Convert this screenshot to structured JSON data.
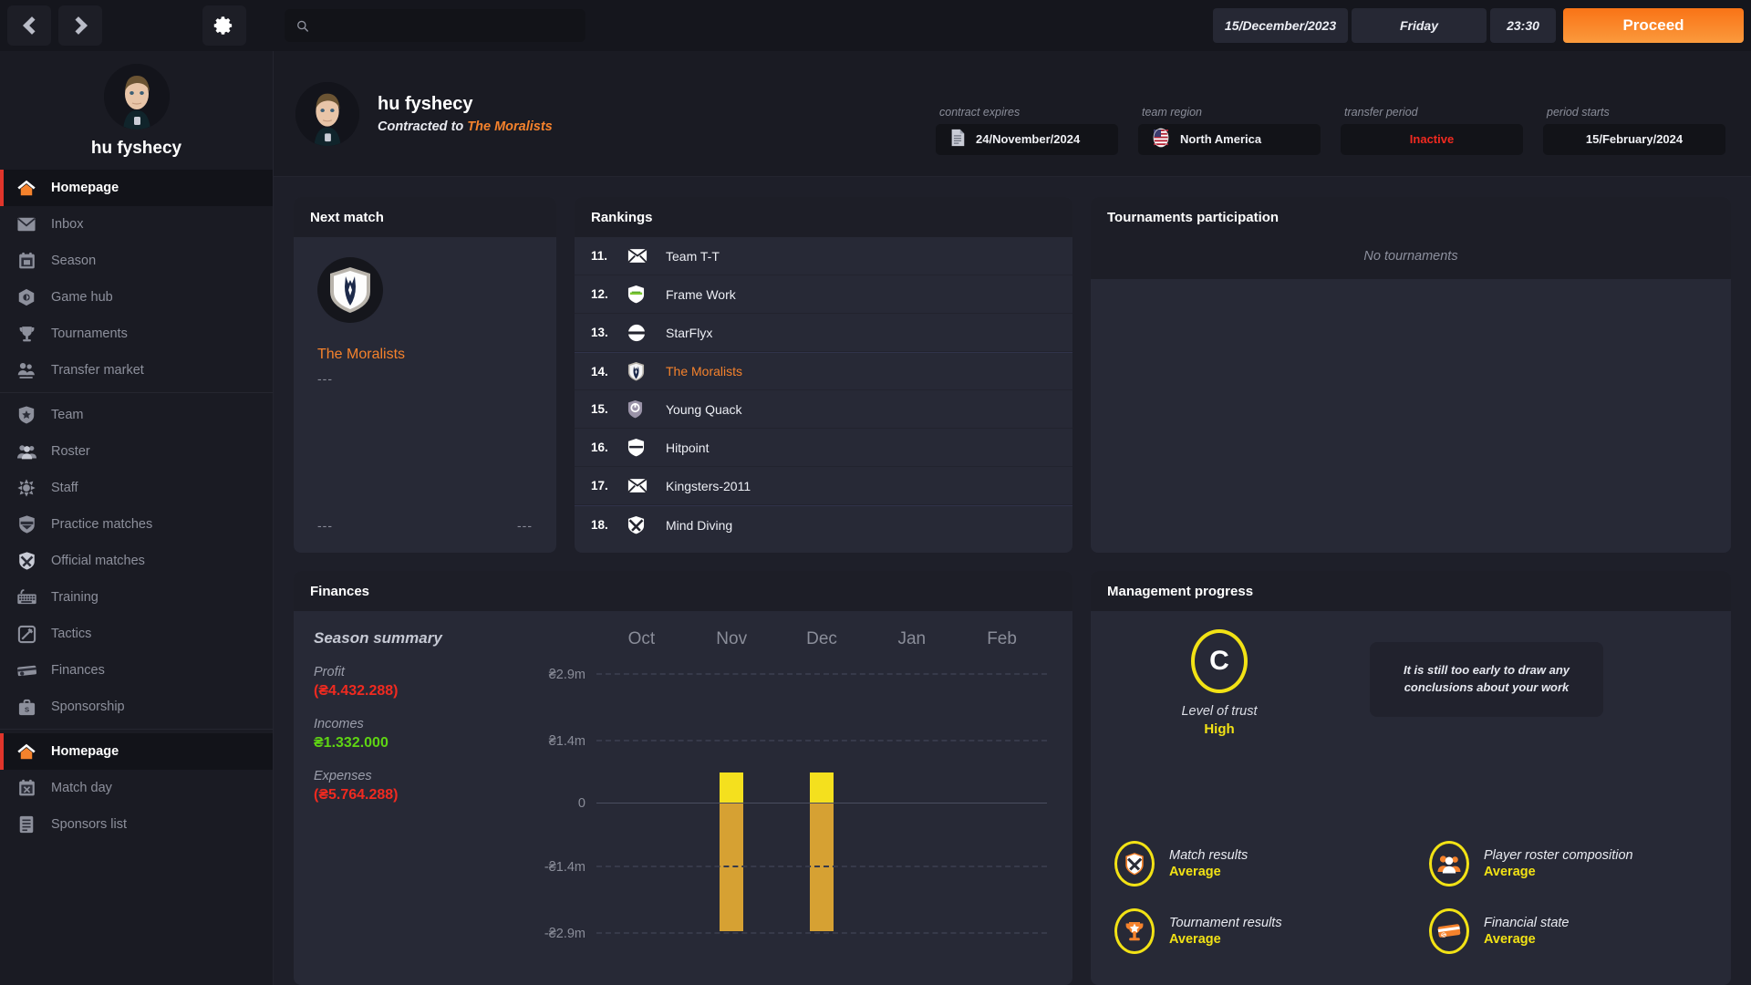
{
  "topbar": {
    "back_icon": "chevron-left-icon",
    "forward_icon": "chevron-right-icon",
    "settings_icon": "gear-icon",
    "search_placeholder": "",
    "search_value": "",
    "date": "15/December/2023",
    "weekday": "Friday",
    "time": "23:30",
    "proceed_label": "Proceed"
  },
  "sidebar": {
    "player_name": "hu fyshecy",
    "items": [
      {
        "label": "Homepage",
        "icon": "home-icon",
        "active": true
      },
      {
        "label": "Inbox",
        "icon": "envelope-icon",
        "active": false
      },
      {
        "label": "Season",
        "icon": "calendar-icon",
        "active": false
      },
      {
        "label": "Game hub",
        "icon": "hub-icon",
        "active": false
      },
      {
        "label": "Tournaments",
        "icon": "trophy-icon",
        "active": false
      },
      {
        "label": "Transfer market",
        "icon": "transfer-icon",
        "active": false
      },
      {
        "label": "Team",
        "icon": "shield-star-icon",
        "active": false
      },
      {
        "label": "Roster",
        "icon": "people-icon",
        "active": false
      },
      {
        "label": "Staff",
        "icon": "staff-icon",
        "active": false
      },
      {
        "label": "Practice matches",
        "icon": "shield-practice-icon",
        "active": false
      },
      {
        "label": "Official matches",
        "icon": "shield-x-icon",
        "active": false
      },
      {
        "label": "Training",
        "icon": "keyboard-icon",
        "active": false
      },
      {
        "label": "Tactics",
        "icon": "tactics-icon",
        "active": false
      },
      {
        "label": "Finances",
        "icon": "card-icon",
        "active": false
      },
      {
        "label": "Sponsorship",
        "icon": "briefcase-icon",
        "active": false
      },
      {
        "label": "Homepage",
        "icon": "home-icon",
        "active": true
      },
      {
        "label": "Match day",
        "icon": "calendar-x-icon",
        "active": false
      },
      {
        "label": "Sponsors list",
        "icon": "list-icon",
        "active": false
      }
    ]
  },
  "player_header": {
    "name": "hu fyshecy",
    "contract_prefix": "Contracted to",
    "team": "The Moralists",
    "metas": [
      {
        "label": "contract expires",
        "value": "24/November/2024",
        "icon": "document-icon",
        "style": "normal"
      },
      {
        "label": "team region",
        "value": "North America",
        "icon": "flag-usa-icon",
        "style": "normal"
      },
      {
        "label": "transfer period",
        "value": "Inactive",
        "icon": "",
        "style": "red"
      },
      {
        "label": "period starts",
        "value": "15/February/2024",
        "icon": "",
        "style": "normal"
      }
    ]
  },
  "next_match": {
    "title": "Next match",
    "team": "The Moralists",
    "score": "---",
    "foot_left": "---",
    "foot_right": "---"
  },
  "rankings": {
    "title": "Rankings",
    "rows": [
      {
        "pos": "11.",
        "team": "Team T-T",
        "logo": "envelope-logo",
        "highlight": false
      },
      {
        "pos": "12.",
        "team": "Frame Work",
        "logo": "shield-green-logo",
        "highlight": false
      },
      {
        "pos": "13.",
        "team": "StarFlyx",
        "logo": "circle-band-logo",
        "highlight": false
      },
      {
        "pos": "14.",
        "team": "The Moralists",
        "logo": "horse-shield-logo",
        "highlight": true
      },
      {
        "pos": "15.",
        "team": "Young Quack",
        "logo": "power-shield-logo",
        "highlight": false
      },
      {
        "pos": "16.",
        "team": "Hitpoint",
        "logo": "shield-white-logo",
        "highlight": false
      },
      {
        "pos": "17.",
        "team": "Kingsters-2011",
        "logo": "envelope-logo",
        "highlight": false
      },
      {
        "pos": "18.",
        "team": "Mind Diving",
        "logo": "shield-x-logo",
        "highlight": false
      }
    ]
  },
  "tournaments": {
    "title": "Tournaments participation",
    "empty_text": "No tournaments"
  },
  "finances": {
    "title": "Finances",
    "summary_title": "Season summary",
    "stats": [
      {
        "key": "Profit",
        "value": "(₴4.432.288)",
        "tone": "neg"
      },
      {
        "key": "Incomes",
        "value": "₴1.332.000",
        "tone": "pos"
      },
      {
        "key": "Expenses",
        "value": "(₴5.764.288)",
        "tone": "neg"
      }
    ]
  },
  "management": {
    "title": "Management progress",
    "trust_grade": "C",
    "trust_label": "Level of trust",
    "trust_value": "High",
    "message": "It is still too early to draw any conclusions about your work",
    "items": [
      {
        "label": "Match results",
        "value": "Average",
        "icon": "shield-x-icon"
      },
      {
        "label": "Player roster composition",
        "value": "Average",
        "icon": "people-icon"
      },
      {
        "label": "Tournament results",
        "value": "Average",
        "icon": "trophy-star-icon"
      },
      {
        "label": "Financial state",
        "value": "Average",
        "icon": "card-icon"
      }
    ]
  },
  "chart_data": {
    "type": "bar",
    "title": "Season summary",
    "categories": [
      "Oct",
      "Nov",
      "Dec",
      "Jan",
      "Feb"
    ],
    "series": [
      {
        "name": "Incomes",
        "values": [
          0,
          0.666,
          0.666,
          0,
          0
        ],
        "color": "#f4e01e"
      },
      {
        "name": "Expenses",
        "values": [
          0,
          -2.88,
          -2.88,
          0,
          0
        ],
        "color": "#d6a133"
      }
    ],
    "ytick_labels": [
      "₴2.9m",
      "₴1.4m",
      "0",
      "-₴1.4m",
      "-₴2.9m"
    ],
    "ytick_values": [
      2.9,
      1.4,
      0,
      -1.4,
      -2.9
    ],
    "ylim": [
      -2.9,
      2.9
    ],
    "xlabel": "",
    "ylabel": "",
    "grid": true,
    "legend": "none",
    "currency": "₴"
  },
  "colors": {
    "accent_orange": "#f5822c",
    "red": "#f02a20",
    "green": "#5fd413",
    "yellow": "#f2e215",
    "bar_positive": "#f4e01e",
    "bar_negative": "#d6a133",
    "panel_bg": "#272936",
    "panel_head": "#1d1e27",
    "sidebar_bg": "#1a1b23",
    "app_bg": "#1e1f29"
  }
}
